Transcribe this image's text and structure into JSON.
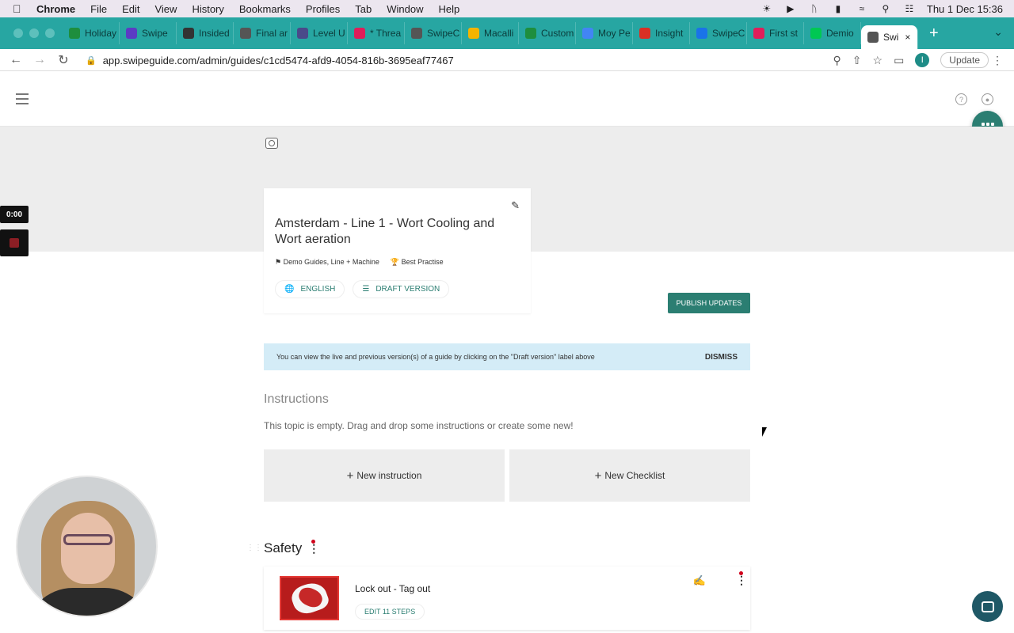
{
  "menubar": {
    "app": "Chrome",
    "items": [
      "File",
      "Edit",
      "View",
      "History",
      "Bookmarks",
      "Profiles",
      "Tab",
      "Window",
      "Help"
    ],
    "datetime": "Thu 1 Dec  15:36"
  },
  "tabs": [
    {
      "label": "Holiday",
      "color": "#1e8e3e"
    },
    {
      "label": "Swipe",
      "color": "#5b3cc4"
    },
    {
      "label": "Insided",
      "color": "#333333"
    },
    {
      "label": "Final ar",
      "color": "#555555"
    },
    {
      "label": "Level U",
      "color": "#4a4a8a"
    },
    {
      "label": "* Threa",
      "color": "#e01e5a"
    },
    {
      "label": "SwipeC",
      "color": "#555555"
    },
    {
      "label": "Macalli",
      "color": "#f4b400"
    },
    {
      "label": "Custom",
      "color": "#1e8e3e"
    },
    {
      "label": "Moy Pe",
      "color": "#4285f4"
    },
    {
      "label": "Insight",
      "color": "#d93025"
    },
    {
      "label": "SwipeC",
      "color": "#1a73e8"
    },
    {
      "label": "First st",
      "color": "#e01e5a"
    },
    {
      "label": "Demio",
      "color": "#00c853"
    },
    {
      "label": "Swi",
      "color": "#555555",
      "active": true
    }
  ],
  "toolbar": {
    "url": "app.swipeguide.com/admin/guides/c1cd5474-afd9-4054-816b-3695eaf77467",
    "profile_initial": "I",
    "update_label": "Update"
  },
  "guide": {
    "title": "Amsterdam - Line 1 - Wort Cooling and Wort aeration",
    "tags": "Demo Guides, Line + Machine",
    "badge": "Best Practise",
    "language": "ENGLISH",
    "version": "DRAFT VERSION"
  },
  "publish_label": "PUBLISH UPDATES",
  "info": {
    "message": "You can view the live and previous version(s) of a guide by clicking on the \"Draft version\" label above",
    "dismiss_label": "DISMISS"
  },
  "instructions": {
    "heading": "Instructions",
    "empty_text": "This topic is empty. Drag and drop some instructions or create some new!",
    "new_instruction": "New instruction",
    "new_checklist": "New Checklist"
  },
  "safety": {
    "heading": "Safety",
    "item_title": "Lock out - Tag out",
    "edit_steps": "EDIT 11 STEPS"
  },
  "recorder": {
    "time": "0:00"
  }
}
